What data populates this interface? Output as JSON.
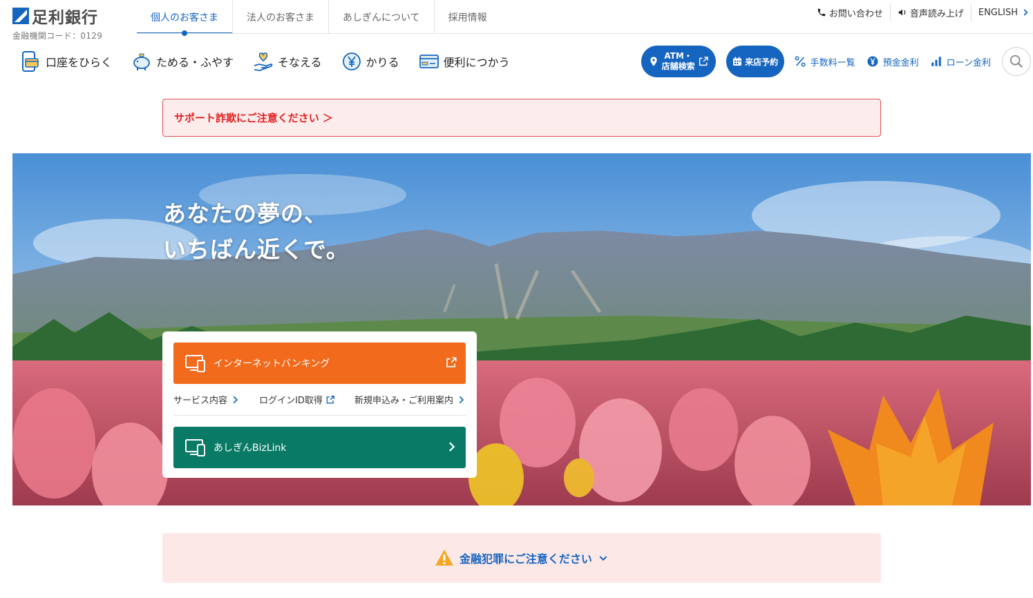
{
  "brand": {
    "name": "足利銀行",
    "code_label": "金融機関コード：0129"
  },
  "top_tabs": [
    {
      "label": "個人のお客さま",
      "active": true
    },
    {
      "label": "法人のお客さま",
      "active": false
    },
    {
      "label": "あしぎんについて",
      "active": false
    },
    {
      "label": "採用情報",
      "active": false
    }
  ],
  "utility": {
    "contact": "お問い合わせ",
    "read_aloud": "音声読み上げ",
    "english": "ENGLISH"
  },
  "main_nav": [
    {
      "label": "口座をひらく",
      "icon": "card-phone-icon"
    },
    {
      "label": "ためる・ふやす",
      "icon": "piggy-bank-icon"
    },
    {
      "label": "そなえる",
      "icon": "heart-hand-icon"
    },
    {
      "label": "かりる",
      "icon": "yen-coin-icon"
    },
    {
      "label": "便利につかう",
      "icon": "credit-card-icon"
    }
  ],
  "right_nav": {
    "atm_line1": "ATM・",
    "atm_line2": "店舗検索",
    "visit": "来店予約",
    "fees": "手数料一覧",
    "deposit_rate": "預金金利",
    "loan_rate": "ローン金利"
  },
  "alert_top": "サポート詐欺にご注意ください ＞",
  "hero": {
    "title_line1": "あなたの夢の、",
    "title_line2": "いちばん近くで。"
  },
  "banking": {
    "internet_banking": "インターネットバンキング",
    "links": {
      "service": "サービス内容",
      "login_id": "ログインID取得",
      "signup": "新規申込み・ご利用案内"
    },
    "bizlink": "あしぎんBizLink"
  },
  "alert_bottom": "金融犯罪にご注意ください",
  "colors": {
    "primary": "#1565c0",
    "orange": "#f26a1b",
    "green": "#087a66",
    "alert_red": "#e02020"
  }
}
